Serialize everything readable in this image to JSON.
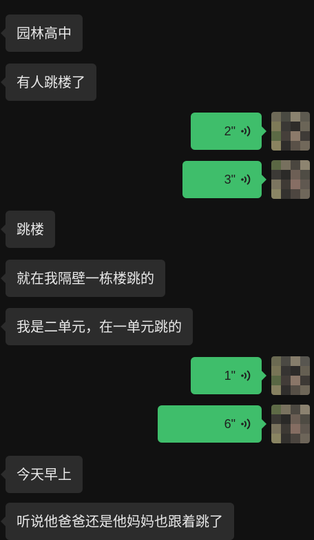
{
  "messages": [
    {
      "side": "in",
      "text": "园林高中"
    },
    {
      "side": "in",
      "text": "有人跳楼了"
    },
    {
      "side": "out",
      "type": "voice",
      "duration": "2\""
    },
    {
      "side": "out",
      "type": "voice",
      "duration": "3\""
    },
    {
      "side": "in",
      "text": "跳楼"
    },
    {
      "side": "in",
      "text": "就在我隔壁一栋楼跳的"
    },
    {
      "side": "in",
      "text": "我是二单元，在一单元跳的"
    },
    {
      "side": "out",
      "type": "voice",
      "duration": "1\""
    },
    {
      "side": "out",
      "type": "voice",
      "duration": "6\""
    },
    {
      "side": "in",
      "text": "今天早上"
    },
    {
      "side": "in",
      "text": "听说他爸爸还是他妈妈也跟着跳了"
    }
  ],
  "icons": {
    "voice": "voice-wave-icon",
    "avatar": "pixelated-avatar"
  },
  "colors": {
    "background": "#111111",
    "incoming_bubble": "#2c2c2c",
    "outgoing_bubble": "#3fbe6b"
  }
}
